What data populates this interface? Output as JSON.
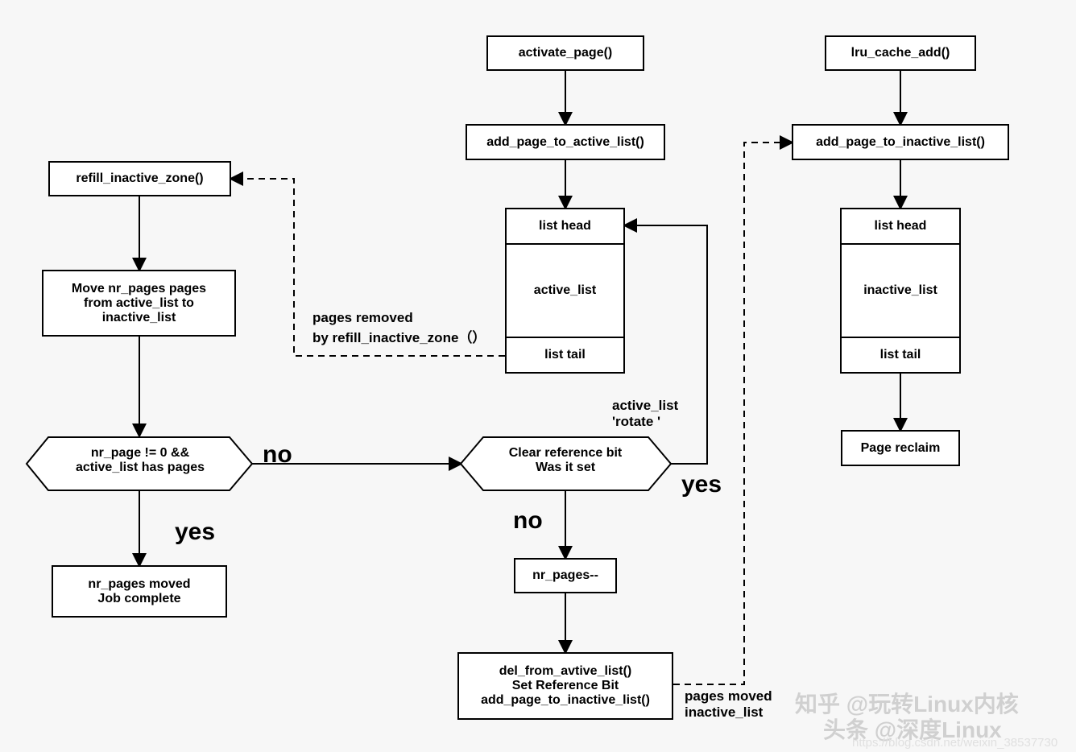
{
  "nodes": {
    "activate_page": "activate_page()",
    "add_page_active": "add_page_to_active_list()",
    "active_listbox": {
      "head": "list head",
      "body": "active_list",
      "tail": "list tail"
    },
    "refill_inactive_zone": "refill_inactive_zone()",
    "move_nr_pages": "Move nr_pages pages\nfrom active_list to\ninactive_list",
    "decision_left": "nr_page != 0 &&\nactive_list has pages",
    "nr_pages_moved": "nr_pages moved\nJob complete",
    "decision_mid": "Clear reference bit\nWas it set",
    "nr_pages_dec": "nr_pages--",
    "del_set_add": "del_from_avtive_list()\nSet Reference Bit\nadd_page_to_inactive_list()",
    "lru_cache_add": "lru_cache_add()",
    "add_page_inactive": "add_page_to_inactive_list()",
    "inactive_listbox": {
      "head": "list head",
      "body": "inactive_list",
      "tail": "list tail"
    },
    "page_reclaim": "Page reclaim"
  },
  "edges": {
    "no_left": "no",
    "yes_left": "yes",
    "no_mid": "no",
    "yes_mid": "yes",
    "rotate": "active_list\n'rotate '",
    "removed": "pages removed\nby refill_inactive_zone（）",
    "moved_inactive": "pages moved\ninactive_list"
  },
  "watermarks": {
    "zhihu": "知乎 @玩转Linux内核",
    "toutiao": "头条 @深度Linux",
    "csdn": "https://blog.csdn.net/weixin_38537730"
  }
}
